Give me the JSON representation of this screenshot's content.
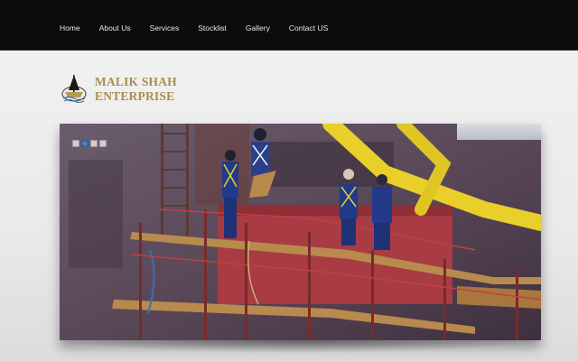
{
  "nav": {
    "items": [
      {
        "label": "Home"
      },
      {
        "label": "About Us"
      },
      {
        "label": "Services"
      },
      {
        "label": "Stocklist"
      },
      {
        "label": "Gallery"
      },
      {
        "label": "Contact US"
      }
    ]
  },
  "brand": {
    "line1": "MALIK SHAH",
    "line2": "ENTERPRISE",
    "color": "#a98d4a"
  },
  "slider": {
    "slide_count": 4,
    "active_index": 1,
    "image_alt": "Workers on scaffolding painting a ship hull"
  },
  "colors": {
    "topbar": "#0c0c0c",
    "brand": "#a98d4a",
    "dot_active": "#3b86c6"
  }
}
